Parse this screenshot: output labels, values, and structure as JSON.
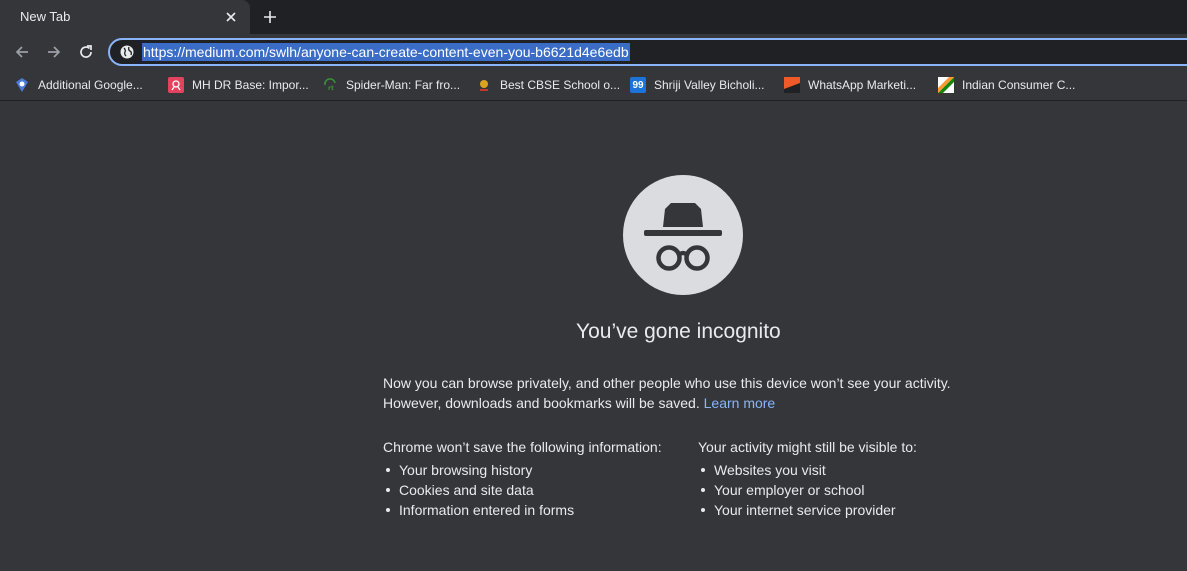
{
  "tab": {
    "title": "New Tab"
  },
  "omnibox": {
    "url": "https://medium.com/swlh/anyone-can-create-content-even-you-b6621d4e6edb"
  },
  "bookmarks": [
    {
      "label": "Additional Google...",
      "icon": "bookmark-favicon-blue"
    },
    {
      "label": "MH DR Base: Impor...",
      "icon": "bookmark-favicon-pink"
    },
    {
      "label": "Spider-Man: Far fro...",
      "icon": "bookmark-favicon-green"
    },
    {
      "label": "Best CBSE School o...",
      "icon": "bookmark-favicon-gold"
    },
    {
      "label": "Shriji Valley Bicholi...",
      "icon_text": "99",
      "icon": "bookmark-favicon-99"
    },
    {
      "label": "WhatsApp Marketi...",
      "icon": "bookmark-favicon-orange"
    },
    {
      "label": "Indian Consumer C...",
      "icon": "bookmark-favicon-flag"
    }
  ],
  "content": {
    "heading": "You’ve gone incognito",
    "intro_line1": "Now you can browse privately, and other people who use this device won’t see your activity.",
    "intro_line2": "However, downloads and bookmarks will be saved.",
    "learn_more": "Learn more",
    "left_title_prefix": "Chrome ",
    "left_title_bold": "won’t save",
    "left_title_suffix": " the following information:",
    "left_items": [
      "Your browsing history",
      "Cookies and site data",
      "Information entered in forms"
    ],
    "right_title_prefix": "Your activity ",
    "right_title_bold": "might still be visible",
    "right_title_suffix": " to:",
    "right_items": [
      "Websites you visit",
      "Your employer or school",
      "Your internet service provider"
    ]
  },
  "colors": {
    "frame": "#202124",
    "toolbar": "#35363a",
    "text": "#e8eaed",
    "link": "#8ab4f8",
    "selection": "#3b6dc7"
  }
}
